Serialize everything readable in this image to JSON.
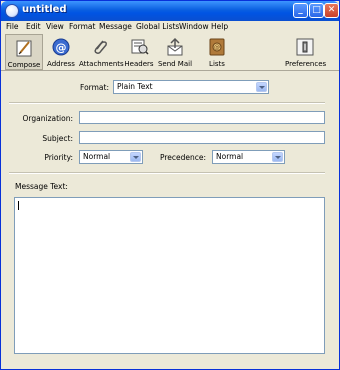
{
  "window": {
    "title": "untitled"
  },
  "menu": [
    "File",
    "Edit",
    "View",
    "Format",
    "Message",
    "Global Lists",
    "Window",
    "Help"
  ],
  "toolbar": {
    "compose": "Compose",
    "address": "Address",
    "attachments": "Attachments",
    "headers": "Headers",
    "send_mail": "Send Mail",
    "lists": "Lists",
    "preferences": "Preferences"
  },
  "form": {
    "format_label": "Format:",
    "format_value": "Plain Text",
    "organization_label": "Organization:",
    "organization_value": "",
    "subject_label": "Subject:",
    "subject_value": "",
    "priority_label": "Priority:",
    "priority_value": "Normal",
    "precedence_label": "Precedence:",
    "precedence_value": "Normal",
    "message_label": "Message Text:",
    "message_value": ""
  }
}
